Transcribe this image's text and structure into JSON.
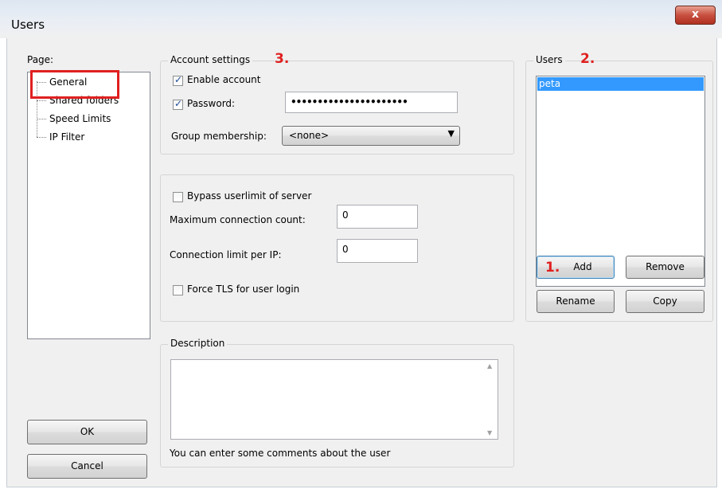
{
  "window": {
    "title": "Users",
    "close_glyph": "x"
  },
  "page": {
    "label": "Page:",
    "items": [
      "General",
      "Shared folders",
      "Speed Limits",
      "IP Filter"
    ]
  },
  "account": {
    "legend": "Account settings",
    "enable_label": "Enable account",
    "enable_checked": true,
    "password_label": "Password:",
    "password_checked": true,
    "password_value": "••••••••••••••••••••••",
    "group_label": "Group membership:",
    "group_value": "<none>"
  },
  "limits": {
    "bypass_label": "Bypass userlimit of server",
    "bypass_checked": false,
    "max_conn_label": "Maximum connection count:",
    "max_conn_value": "0",
    "per_ip_label": "Connection limit per IP:",
    "per_ip_value": "0",
    "force_tls_label": "Force TLS for user login",
    "force_tls_checked": false
  },
  "description": {
    "legend": "Description",
    "value": "",
    "hint": "You can enter some comments about the user"
  },
  "users": {
    "legend": "Users",
    "items": [
      "peta"
    ],
    "selected": "peta",
    "add_label": "Add",
    "remove_label": "Remove",
    "rename_label": "Rename",
    "copy_label": "Copy"
  },
  "buttons": {
    "ok_label": "OK",
    "cancel_label": "Cancel"
  },
  "annotations": {
    "step1": "1.",
    "step2": "2.",
    "step3": "3."
  },
  "colors": {
    "annotation": "#e02020",
    "selection": "#3399ff",
    "close": "#c75040"
  }
}
